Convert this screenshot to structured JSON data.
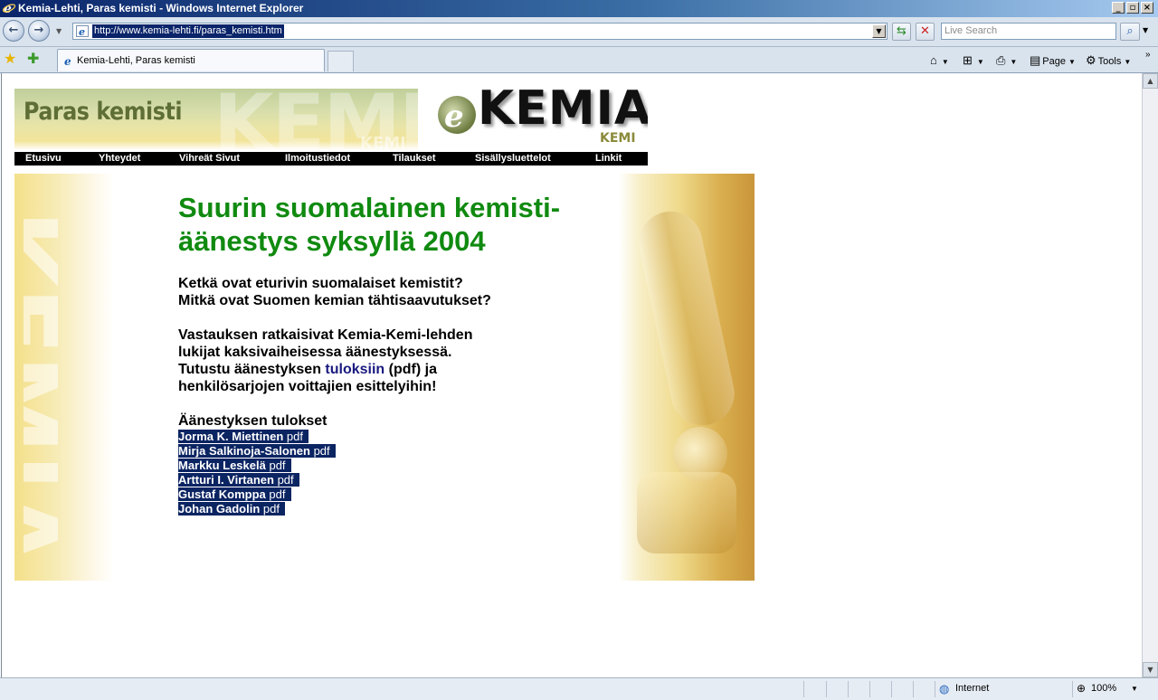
{
  "window": {
    "title": "Kemia-Lehti, Paras kemisti - Windows Internet Explorer"
  },
  "address": {
    "url": "http://www.kemia-lehti.fi/paras_kemisti.htm",
    "search_placeholder": "Live Search"
  },
  "tab": {
    "label": "Kemia-Lehti, Paras kemisti"
  },
  "commands": {
    "page": "Page",
    "tools": "Tools"
  },
  "banner": {
    "title": "Paras kemisti",
    "logo_main": "KEMIA",
    "logo_sub": "KEMI",
    "logo_e": "e"
  },
  "nav": [
    {
      "label": "Etusivu"
    },
    {
      "label": "Yhteydet"
    },
    {
      "label": "Vihreät Sivut"
    },
    {
      "label": "Ilmoitustiedot"
    },
    {
      "label": "Tilaukset"
    },
    {
      "label": "Sisällysluettelot"
    },
    {
      "label": "Linkit"
    }
  ],
  "content": {
    "headline_line1": "Suurin suomalainen kemisti-",
    "headline_line2": "äänestys syksyllä 2004",
    "q1": "Ketkä ovat eturivin suomalaiset kemistit?",
    "q2": "Mitkä ovat Suomen kemian tähtisaavutukset?",
    "p1": "Vastauksen ratkaisivat Kemia-Kemi-lehden",
    "p2": "lukijat kaksivaiheisessa äänestyksessä.",
    "p3_pre": "Tutustu äänestyksen ",
    "p3_link": "tuloksiin",
    "p3_post": " (pdf) ja",
    "p4": "henkilösarjojen voittajien esittelyihin!",
    "results_heading": "Äänestyksen tulokset",
    "results": [
      {
        "name": "Jorma K. Miettinen",
        "pdf": "pdf"
      },
      {
        "name": "Mirja Salkinoja-Salonen",
        "pdf": "pdf"
      },
      {
        "name": "Markku Leskelä",
        "pdf": "pdf"
      },
      {
        "name": "Artturi I. Virtanen",
        "pdf": "pdf"
      },
      {
        "name": "Gustaf Komppa",
        "pdf": "pdf"
      },
      {
        "name": "Johan Gadolin",
        "pdf": "pdf"
      }
    ]
  },
  "statusbar": {
    "zone": "Internet",
    "zoom": "100%"
  },
  "colors": {
    "headline": "#108a10",
    "highlight_bg": "#0b2462",
    "link": "#1a1a80"
  }
}
